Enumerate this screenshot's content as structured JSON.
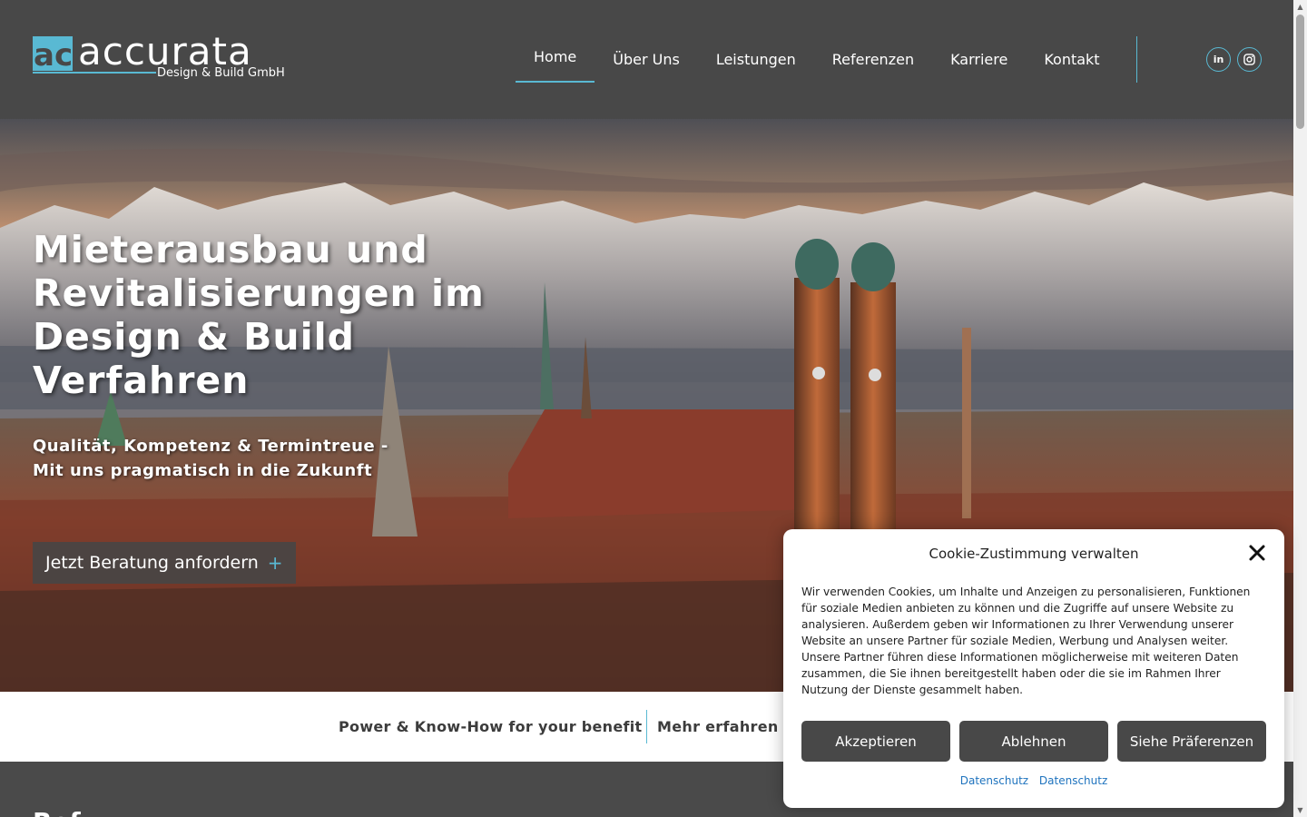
{
  "brand": {
    "name": "accurata",
    "subtitle": "Design & Build GmbH",
    "accent_color": "#59b9d3",
    "header_color": "#484848"
  },
  "nav": {
    "items": [
      {
        "label": "Home",
        "active": true
      },
      {
        "label": "Über Uns",
        "active": false
      },
      {
        "label": "Leistungen",
        "active": false
      },
      {
        "label": "Referenzen",
        "active": false
      },
      {
        "label": "Karriere",
        "active": false
      },
      {
        "label": "Kontakt",
        "active": false
      }
    ],
    "social": [
      {
        "icon": "linkedin-icon",
        "label": "in"
      },
      {
        "icon": "instagram-icon",
        "label": "instagram"
      }
    ]
  },
  "hero": {
    "title": "Mieterausbau und Revitalisierungen im Design & Build Verfahren",
    "subtitle": "Qualität, Kompetenz & Termintreue - Mit uns pragmatisch in die Zukunft",
    "cta_label": "Jetzt Beratung anfordern",
    "cta_icon": "plus-icon"
  },
  "band": {
    "text": "Power & Know-How for your benefit",
    "link": "Mehr erfahren"
  },
  "section2": {
    "heading": "Ref"
  },
  "cookie": {
    "title": "Cookie-Zustimmung verwalten",
    "text": "Wir verwenden Cookies, um Inhalte und Anzeigen zu personalisieren, Funktionen für soziale Medien anbieten zu können und die Zugriffe auf unsere Website zu analysieren. Außerdem geben wir Informationen zu Ihrer Verwendung unserer Website an unsere Partner für soziale Medien, Werbung und Analysen weiter. Unsere Partner führen diese Informationen möglicherweise mit weiteren Daten zusammen, die Sie ihnen bereitgestellt haben oder die sie im Rahmen Ihrer Nutzung der Dienste gesammelt haben.",
    "accept_label": "Akzeptieren",
    "decline_label": "Ablehnen",
    "preferences_label": "Siehe Präferenzen",
    "links": [
      "Datenschutz",
      "Datenschutz"
    ]
  }
}
